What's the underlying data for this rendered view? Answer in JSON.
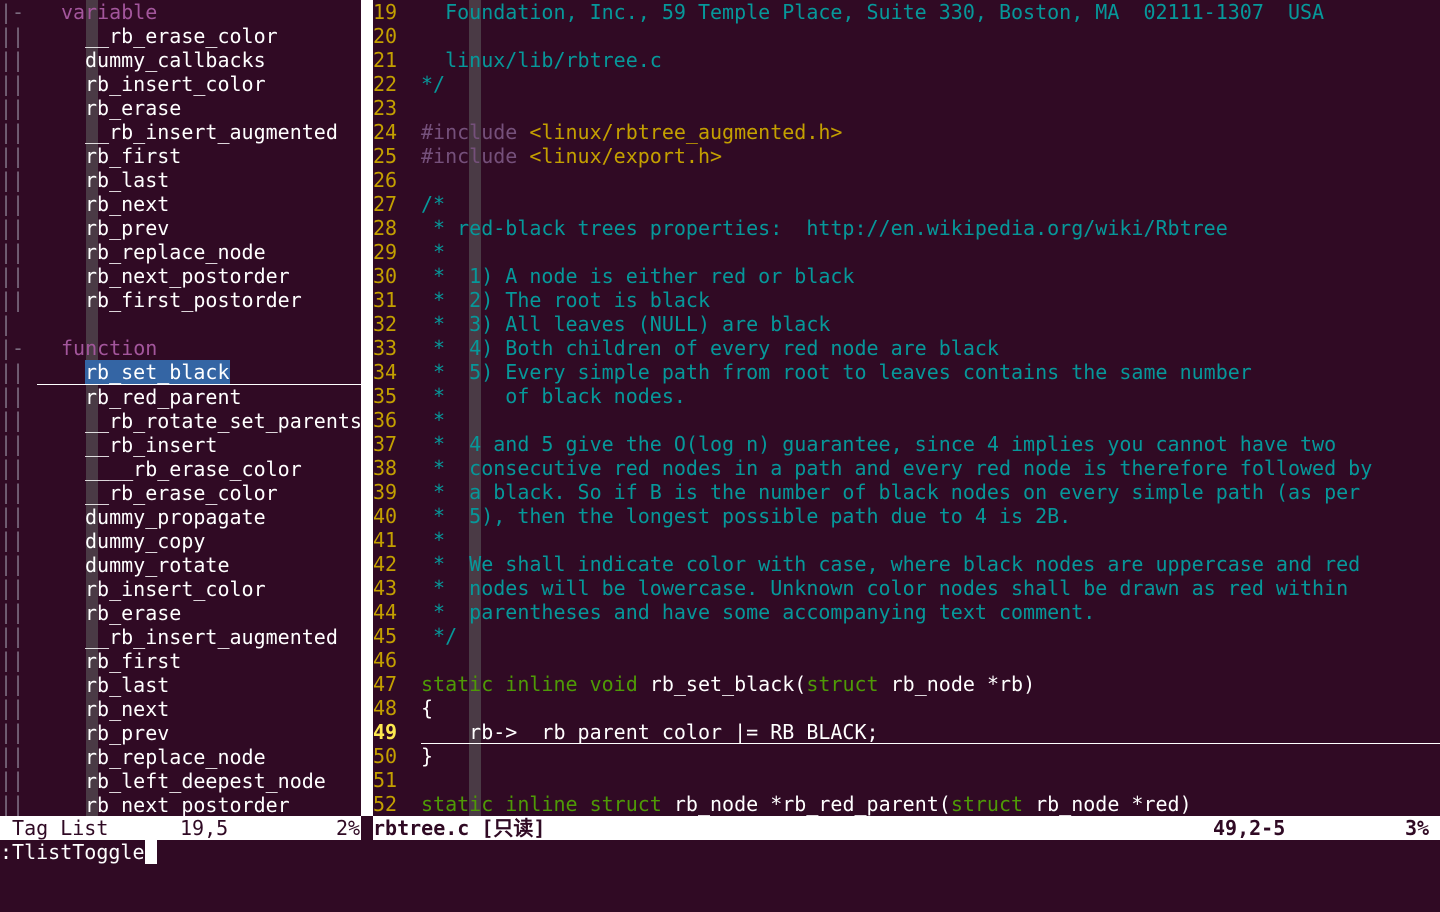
{
  "taglist": {
    "fold": [
      "|-",
      "||",
      "||",
      "||",
      "||",
      "||",
      "||",
      "||",
      "||",
      "||",
      "||",
      "||",
      "||",
      "|",
      "|-",
      "||",
      "||",
      "||",
      "||",
      "||",
      "||",
      "||",
      "||",
      "||",
      "||",
      "||",
      "||",
      "||",
      "||",
      "||",
      "||",
      "||",
      "||",
      "||"
    ],
    "lines": [
      {
        "kind": "group",
        "text": "variable"
      },
      {
        "kind": "tag",
        "text": "__rb_erase_color"
      },
      {
        "kind": "tag",
        "text": "dummy_callbacks"
      },
      {
        "kind": "tag",
        "text": "rb_insert_color"
      },
      {
        "kind": "tag",
        "text": "rb_erase"
      },
      {
        "kind": "tag",
        "text": "__rb_insert_augmented"
      },
      {
        "kind": "tag",
        "text": "rb_first"
      },
      {
        "kind": "tag",
        "text": "rb_last"
      },
      {
        "kind": "tag",
        "text": "rb_next"
      },
      {
        "kind": "tag",
        "text": "rb_prev"
      },
      {
        "kind": "tag",
        "text": "rb_replace_node"
      },
      {
        "kind": "tag",
        "text": "rb_next_postorder"
      },
      {
        "kind": "tag",
        "text": "rb_first_postorder"
      },
      {
        "kind": "blank",
        "text": ""
      },
      {
        "kind": "group",
        "text": "function"
      },
      {
        "kind": "tag",
        "text": "rb_set_black",
        "selected": true
      },
      {
        "kind": "tag",
        "text": "rb_red_parent"
      },
      {
        "kind": "tag",
        "text": "__rb_rotate_set_parents"
      },
      {
        "kind": "tag",
        "text": "__rb_insert"
      },
      {
        "kind": "tag",
        "text": "____rb_erase_color"
      },
      {
        "kind": "tag",
        "text": "__rb_erase_color"
      },
      {
        "kind": "tag",
        "text": "dummy_propagate"
      },
      {
        "kind": "tag",
        "text": "dummy_copy"
      },
      {
        "kind": "tag",
        "text": "dummy_rotate"
      },
      {
        "kind": "tag",
        "text": "rb_insert_color"
      },
      {
        "kind": "tag",
        "text": "rb_erase"
      },
      {
        "kind": "tag",
        "text": "__rb_insert_augmented"
      },
      {
        "kind": "tag",
        "text": "rb_first"
      },
      {
        "kind": "tag",
        "text": "rb_last"
      },
      {
        "kind": "tag",
        "text": "rb_next"
      },
      {
        "kind": "tag",
        "text": "rb_prev"
      },
      {
        "kind": "tag",
        "text": "rb_replace_node"
      },
      {
        "kind": "tag",
        "text": "rb_left_deepest_node"
      },
      {
        "kind": "tag",
        "text": "rb_next_postorder"
      }
    ]
  },
  "code": {
    "lines": [
      {
        "n": "19",
        "segs": [
          {
            "c": "cm",
            "t": "  Foundation, Inc., 59 Temple Place, Suite 330, Boston, MA  02111-1307  USA"
          }
        ]
      },
      {
        "n": "20",
        "segs": []
      },
      {
        "n": "21",
        "segs": [
          {
            "c": "cm",
            "t": "  linux/lib/rbtree.c"
          }
        ]
      },
      {
        "n": "22",
        "segs": [
          {
            "c": "cm",
            "t": "*/"
          }
        ]
      },
      {
        "n": "23",
        "segs": []
      },
      {
        "n": "24",
        "segs": [
          {
            "c": "pp",
            "t": "#include "
          },
          {
            "c": "inc",
            "t": "<linux/rbtree_augmented.h>"
          }
        ]
      },
      {
        "n": "25",
        "segs": [
          {
            "c": "pp",
            "t": "#include "
          },
          {
            "c": "inc",
            "t": "<linux/export.h>"
          }
        ]
      },
      {
        "n": "26",
        "segs": []
      },
      {
        "n": "27",
        "segs": [
          {
            "c": "cm",
            "t": "/*"
          }
        ]
      },
      {
        "n": "28",
        "segs": [
          {
            "c": "cm",
            "t": " * red-black trees properties:  http://en.wikipedia.org/wiki/Rbtree"
          }
        ]
      },
      {
        "n": "29",
        "segs": [
          {
            "c": "cm",
            "t": " *"
          }
        ]
      },
      {
        "n": "30",
        "segs": [
          {
            "c": "cm",
            "t": " *  1) A node is either red or black"
          }
        ]
      },
      {
        "n": "31",
        "segs": [
          {
            "c": "cm",
            "t": " *  2) The root is black"
          }
        ]
      },
      {
        "n": "32",
        "segs": [
          {
            "c": "cm",
            "t": " *  3) All leaves (NULL) are black"
          }
        ]
      },
      {
        "n": "33",
        "segs": [
          {
            "c": "cm",
            "t": " *  4) Both children of every red node are black"
          }
        ]
      },
      {
        "n": "34",
        "segs": [
          {
            "c": "cm",
            "t": " *  5) Every simple path from root to leaves contains the same number"
          }
        ]
      },
      {
        "n": "35",
        "segs": [
          {
            "c": "cm",
            "t": " *     of black nodes."
          }
        ]
      },
      {
        "n": "36",
        "segs": [
          {
            "c": "cm",
            "t": " *"
          }
        ]
      },
      {
        "n": "37",
        "segs": [
          {
            "c": "cm",
            "t": " *  4 and 5 give the O(log n) guarantee, since 4 implies you cannot have two"
          }
        ]
      },
      {
        "n": "38",
        "segs": [
          {
            "c": "cm",
            "t": " *  consecutive red nodes in a path and every red node is therefore followed by"
          }
        ]
      },
      {
        "n": "39",
        "segs": [
          {
            "c": "cm",
            "t": " *  a black. So if B is the number of black nodes on every simple path (as per"
          }
        ]
      },
      {
        "n": "40",
        "segs": [
          {
            "c": "cm",
            "t": " *  5), then the longest possible path due to 4 is 2B."
          }
        ]
      },
      {
        "n": "41",
        "segs": [
          {
            "c": "cm",
            "t": " *"
          }
        ]
      },
      {
        "n": "42",
        "segs": [
          {
            "c": "cm",
            "t": " *  We shall indicate color with case, where black nodes are uppercase and red"
          }
        ]
      },
      {
        "n": "43",
        "segs": [
          {
            "c": "cm",
            "t": " *  nodes will be lowercase. Unknown color nodes shall be drawn as red within"
          }
        ]
      },
      {
        "n": "44",
        "segs": [
          {
            "c": "cm",
            "t": " *  parentheses and have some accompanying text comment."
          }
        ]
      },
      {
        "n": "45",
        "segs": [
          {
            "c": "cm",
            "t": " */"
          }
        ]
      },
      {
        "n": "46",
        "segs": []
      },
      {
        "n": "47",
        "segs": [
          {
            "c": "kw",
            "t": "static inline void"
          },
          {
            "c": "",
            "t": " rb_set_black("
          },
          {
            "c": "kw",
            "t": "struct"
          },
          {
            "c": "",
            "t": " rb_node *rb)"
          }
        ]
      },
      {
        "n": "48",
        "segs": [
          {
            "c": "",
            "t": "{"
          }
        ]
      },
      {
        "n": "49",
        "current": true,
        "segs": [
          {
            "c": "",
            "t": "    rb->__rb_parent_color |= RB_BLACK;"
          }
        ]
      },
      {
        "n": "50",
        "segs": [
          {
            "c": "",
            "t": "}"
          }
        ]
      },
      {
        "n": "51",
        "segs": []
      },
      {
        "n": "52",
        "segs": [
          {
            "c": "kw",
            "t": "static inline struct"
          },
          {
            "c": "",
            "t": " rb_node *rb_red_parent("
          },
          {
            "c": "kw",
            "t": "struct"
          },
          {
            "c": "",
            "t": " rb_node *red)"
          }
        ]
      }
    ]
  },
  "status": {
    "left_title": " Tag List",
    "left_pos": "19,5",
    "left_pct": "2%",
    "right_file": "rbtree.c [只读]",
    "right_pos": "49,2-5",
    "right_pct": "3%"
  },
  "cmdline": ":TlistToggle"
}
